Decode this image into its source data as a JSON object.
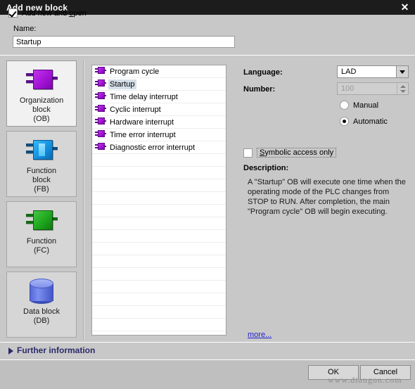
{
  "window": {
    "title": "Add new block",
    "close_icon": "close-icon"
  },
  "name_field": {
    "label": "Name:",
    "value": "Startup"
  },
  "categories": [
    {
      "label_line1": "Organization",
      "label_line2": "block",
      "label_line3": "(OB)",
      "icon": "organization-block-icon",
      "selected": true
    },
    {
      "label_line1": "Function",
      "label_line2": "block",
      "label_line3": "(FB)",
      "icon": "function-block-icon",
      "selected": false
    },
    {
      "label_line1": "Function",
      "label_line2": "",
      "label_line3": "(FC)",
      "icon": "function-icon",
      "selected": false
    },
    {
      "label_line1": "Data block",
      "label_line2": "",
      "label_line3": "(DB)",
      "icon": "data-block-icon",
      "selected": false
    }
  ],
  "block_list": {
    "items": [
      {
        "label": "Program cycle",
        "selected": false
      },
      {
        "label": "Startup",
        "selected": true
      },
      {
        "label": "Time delay interrupt",
        "selected": false
      },
      {
        "label": "Cyclic interrupt",
        "selected": false
      },
      {
        "label": "Hardware interrupt",
        "selected": false
      },
      {
        "label": "Time error interrupt",
        "selected": false
      },
      {
        "label": "Diagnostic error interrupt",
        "selected": false
      }
    ]
  },
  "properties": {
    "language_label": "Language:",
    "language_value": "LAD",
    "number_label": "Number:",
    "number_value": "100",
    "radio_manual": "Manual",
    "radio_automatic": "Automatic",
    "selected_radio": "Automatic",
    "symbolic_access_label": "Symbolic access only",
    "symbolic_access_checked": false,
    "description_label": "Description:",
    "description_text": "A \"Startup\" OB will execute one time when the operating mode of the PLC changes from STOP to RUN. After completion, the main \"Program cycle\" OB will begin executing.",
    "more_link": "more..."
  },
  "further_information": {
    "label": "Further information",
    "expander_icon": "chevron-right-icon",
    "expanded": false
  },
  "footer": {
    "add_new_and_open_label": "Add new and open",
    "add_new_and_open_checked": true,
    "ok_label": "OK",
    "cancel_label": "Cancel"
  },
  "watermark": {
    "text": "www.diangon.com"
  },
  "colors": {
    "titlebar_bg": "#1c1c1c",
    "dialog_bg": "#c8c8c8",
    "footer_bg": "#bfbfbf",
    "selection_bg": "#d5dfe9",
    "link": "#2020d0",
    "further_info_text": "#2b2b6b",
    "ob_icon": "#a313d6",
    "fb_icon": "#1390e0",
    "fc_icon": "#1ea71c",
    "db_icon": "#5668d8"
  }
}
